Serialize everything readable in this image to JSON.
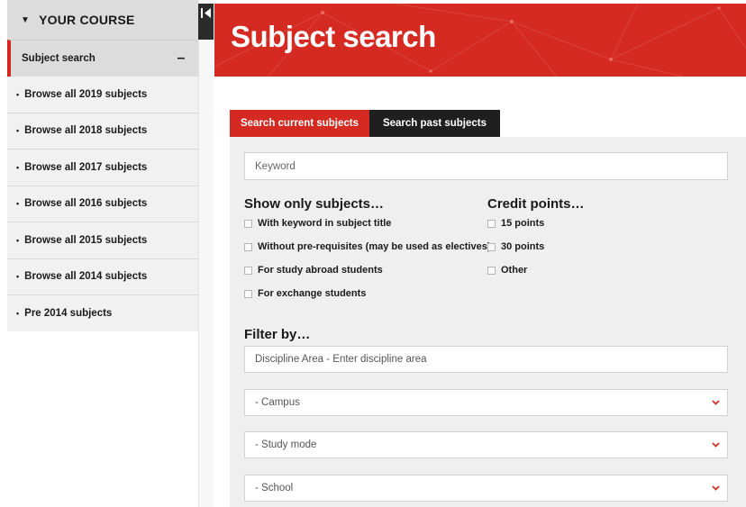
{
  "sidebar": {
    "course_header": "YOUR COURSE",
    "active_item": "Subject search",
    "items": [
      {
        "label": "Browse all 2019 subjects"
      },
      {
        "label": "Browse all 2018 subjects"
      },
      {
        "label": "Browse all 2017 subjects"
      },
      {
        "label": "Browse all 2016 subjects"
      },
      {
        "label": "Browse all 2015 subjects"
      },
      {
        "label": "Browse all 2014 subjects"
      },
      {
        "label": "Pre 2014 subjects"
      }
    ]
  },
  "banner": {
    "title": "Subject search"
  },
  "tabs": {
    "current": "Search current subjects",
    "past": "Search past subjects"
  },
  "search": {
    "keyword_placeholder": "Keyword"
  },
  "show_only": {
    "heading": "Show only subjects…",
    "options": [
      {
        "label": "With keyword in subject title"
      },
      {
        "label": "Without pre-requisites (may be used as electives)"
      },
      {
        "label": "For study abroad students"
      },
      {
        "label": "For exchange students"
      }
    ]
  },
  "credit_points": {
    "heading": "Credit points…",
    "options": [
      {
        "label": "15 points"
      },
      {
        "label": "30 points"
      },
      {
        "label": "Other"
      }
    ]
  },
  "filter": {
    "heading": "Filter by…",
    "discipline_placeholder": "Discipline Area - Enter discipline area",
    "campus": "- Campus",
    "study_mode": "- Study mode",
    "school": "- School"
  },
  "colors": {
    "brand_red": "#d42a22",
    "tab_dark": "#1f1f1f",
    "panel_bg": "#efefef",
    "sidebar_bg": "#f1f1f1"
  }
}
